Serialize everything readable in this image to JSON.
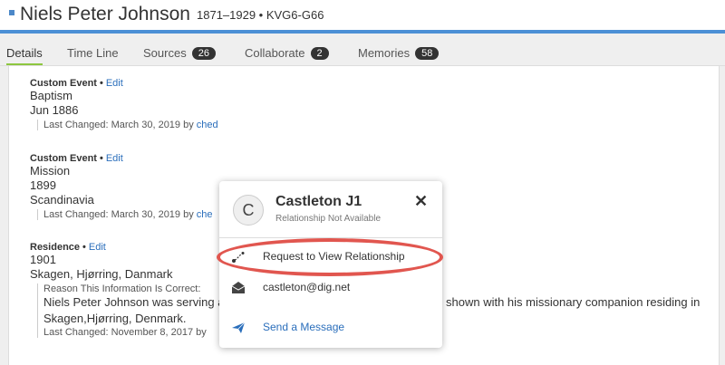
{
  "header": {
    "name": "Niels Peter Johnson",
    "meta": "1871–1929 • KVG6-G66"
  },
  "tabs": [
    {
      "label": "Details",
      "count": null
    },
    {
      "label": "Time Line",
      "count": null
    },
    {
      "label": "Sources",
      "count": "26"
    },
    {
      "label": "Collaborate",
      "count": "2"
    },
    {
      "label": "Memories",
      "count": "58"
    }
  ],
  "events": [
    {
      "title": "Custom Event",
      "edit": "Edit",
      "lines": [
        "Baptism",
        "Jun 1886"
      ],
      "changed_prefix": "Last Changed: March 30, 2019 by",
      "changed_user": "ched"
    },
    {
      "title": "Custom Event",
      "edit": "Edit",
      "lines": [
        "Mission",
        "1899",
        "Scandinavia"
      ],
      "changed_prefix": "Last Changed: March 30, 2019 by",
      "changed_user": "che"
    },
    {
      "title": "Residence",
      "edit": "Edit",
      "lines": [
        "1901",
        "Skagen, Hjørring, Danmark"
      ],
      "reason_label": "Reason This Information Is Correct:",
      "reason_left": "Niels Peter Johnson was serving a",
      "reason_right": "shown with his missionary companion residing in",
      "reason_line2": "Skagen,Hjørring, Denmark.",
      "changed_prefix": "Last Changed: November 8, 2017 by"
    }
  ],
  "popover": {
    "avatar_letter": "C",
    "name": "Castleton J1",
    "subtitle": "Relationship Not Available",
    "close": "✕",
    "request": "Request to View Relationship",
    "email": "castleton@dig.net",
    "message": "Send a Message"
  },
  "colors": {
    "accent": "#4c90d6",
    "link": "#2a6ebb",
    "highlight": "#e1564f",
    "active_tab": "#8dc63f"
  }
}
